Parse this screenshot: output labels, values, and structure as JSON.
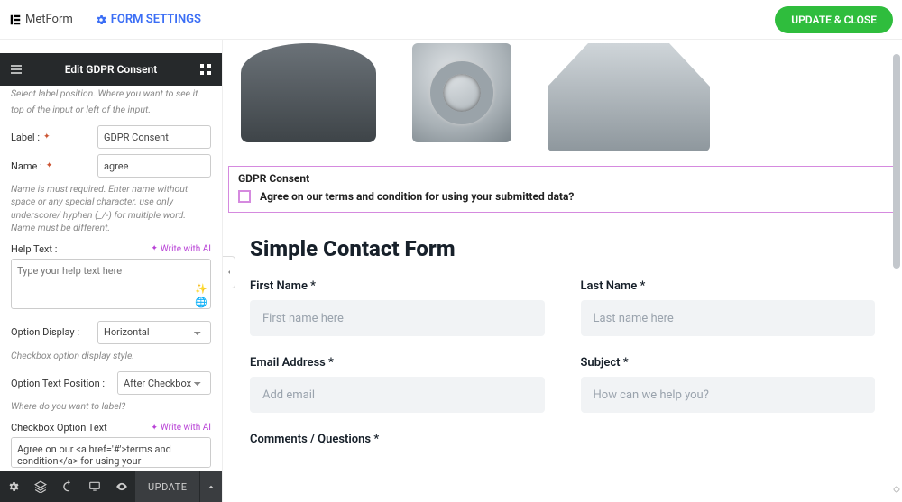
{
  "topbar": {
    "app_name": "MetForm",
    "settings_label": "FORM SETTINGS",
    "update_close": "UPDATE & CLOSE"
  },
  "panel": {
    "title": "Edit GDPR Consent",
    "cutoff_hint": "Select label position. Where you want to see it.",
    "position_hint": "top of the input or left of the input.",
    "label_lbl": "Label :",
    "label_value": "GDPR Consent",
    "name_lbl": "Name :",
    "name_value": "agree",
    "name_hint": "Name is must required. Enter name without space or any special character. use only underscore/ hyphen (_/-) for multiple word. Name must be different.",
    "help_lbl": "Help Text :",
    "help_placeholder": "Type your help text here",
    "write_ai": "Write with AI",
    "option_display_lbl": "Option Display :",
    "option_display_value": "Horizontal",
    "option_display_hint": "Checkbox option display style.",
    "option_text_pos_lbl": "Option Text Position :",
    "option_text_pos_value": "After Checkbox",
    "option_text_pos_hint": "Where do you want to label?",
    "checkbox_option_lbl": "Checkbox Option Text",
    "checkbox_option_value": "Agree on our <a href='#'>terms and condition</a> for using your"
  },
  "footer": {
    "update": "UPDATE"
  },
  "preview": {
    "gdpr_title": "GDPR Consent",
    "gdpr_text": "Agree on our terms and condition for using your submitted data?",
    "form_title": "Simple Contact Form",
    "first_name_lbl": "First Name *",
    "first_name_ph": "First name here",
    "last_name_lbl": "Last Name *",
    "last_name_ph": "Last name here",
    "email_lbl": "Email Address *",
    "email_ph": "Add email",
    "subject_lbl": "Subject *",
    "subject_ph": "How can we help you?",
    "comments_lbl": "Comments / Questions *"
  }
}
